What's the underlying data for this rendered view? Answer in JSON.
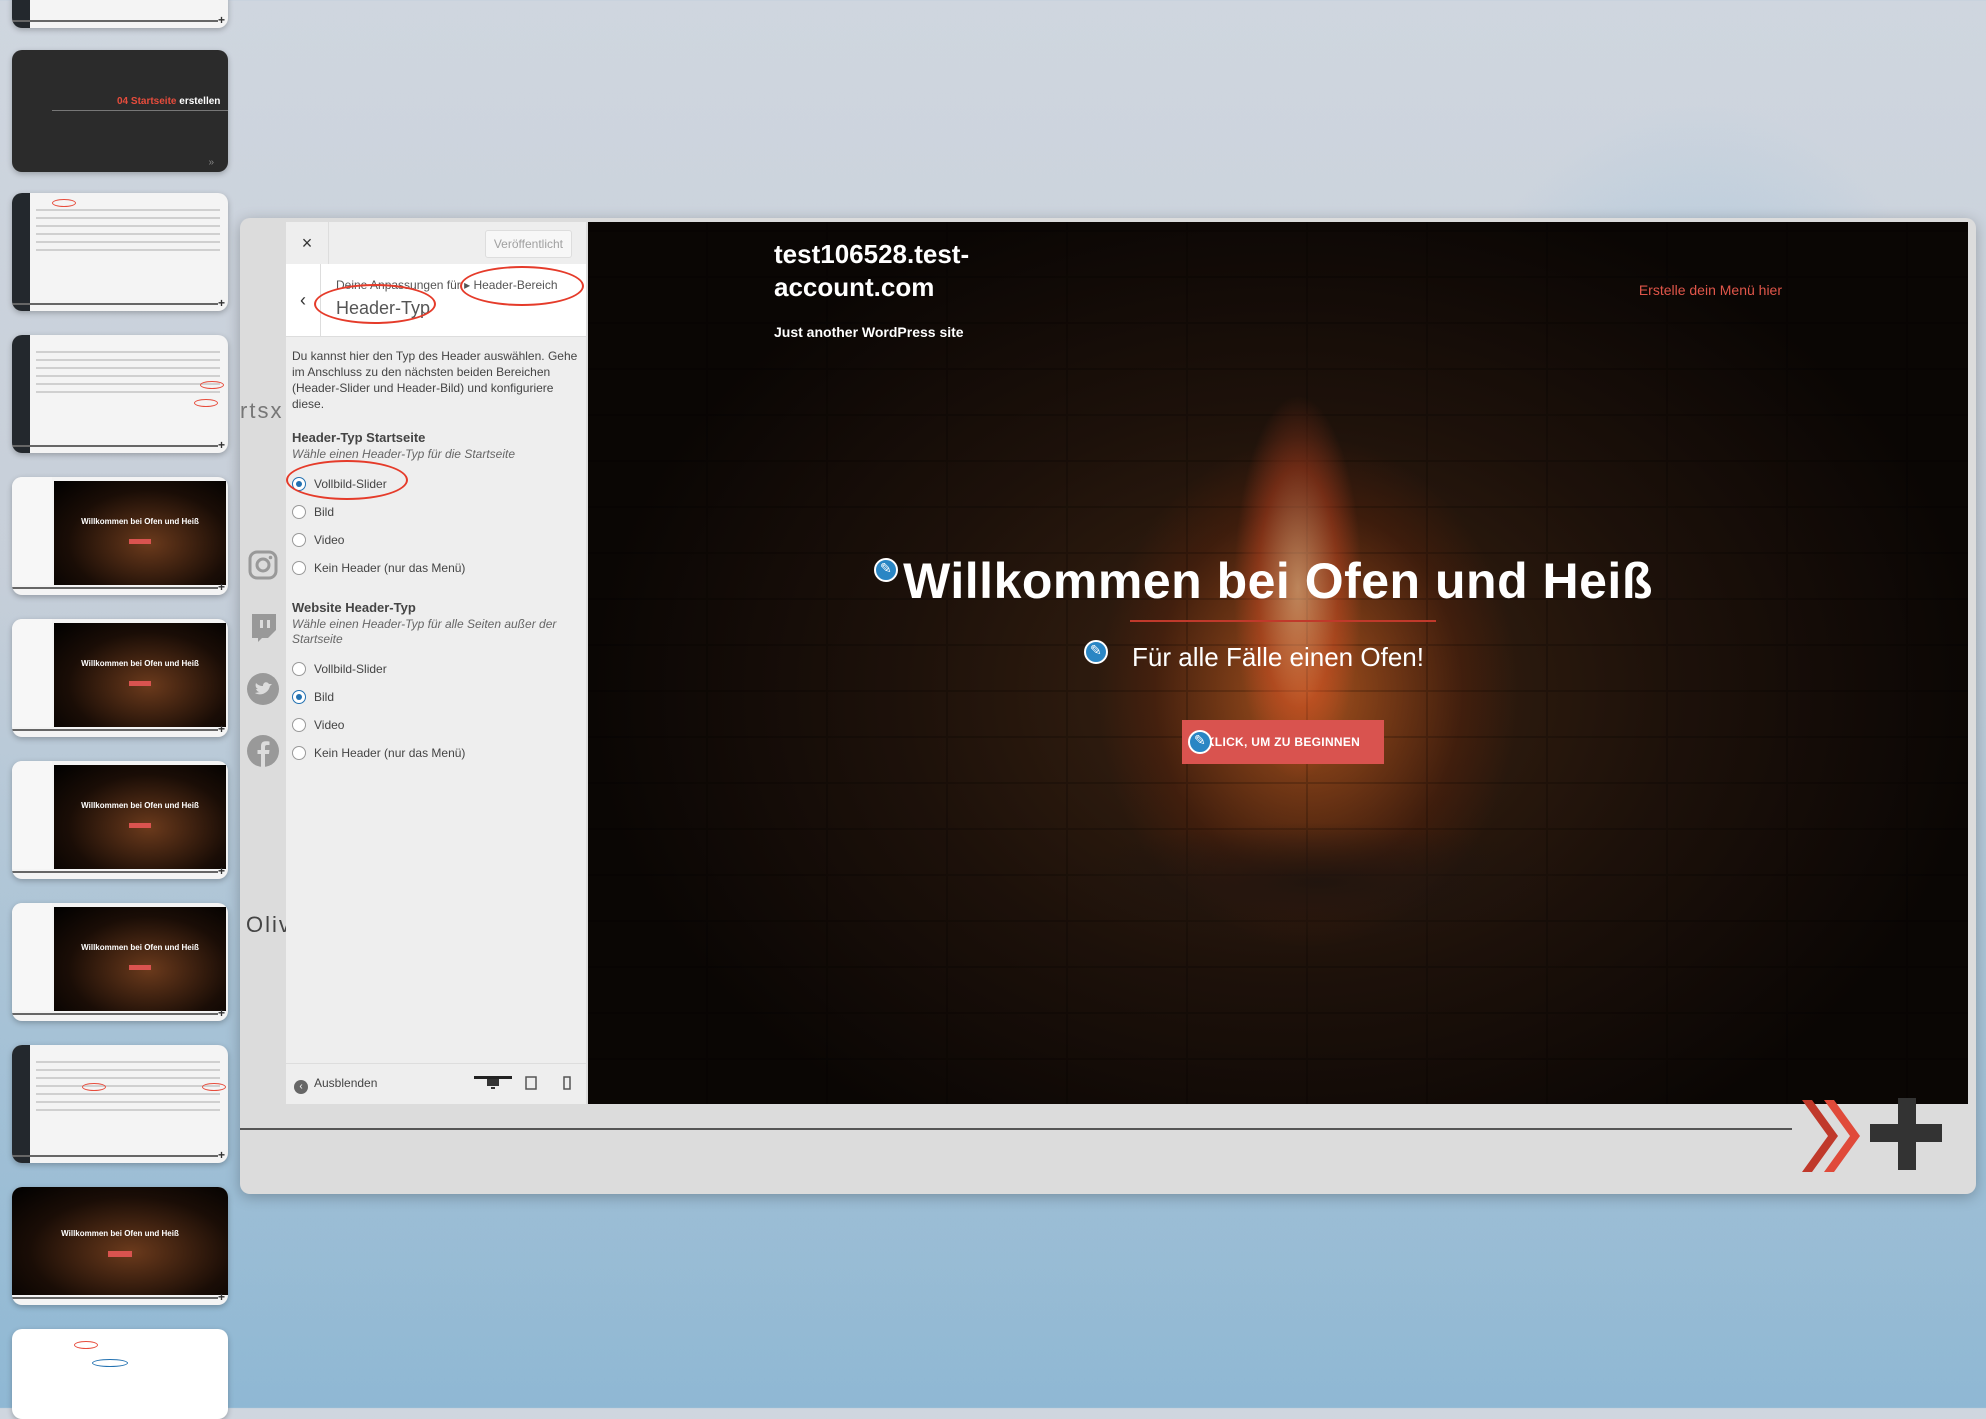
{
  "thumbnails": {
    "slide_title_red": "04 Startseite",
    "slide_title_white": "erstellen",
    "mini_hero_title": "Willkommen bei Ofen und Heiß"
  },
  "side_texts": {
    "left_top": "rtsx",
    "left_bottom": "Oliv"
  },
  "social_icons": [
    "instagram-icon",
    "twitch-icon",
    "twitter-icon",
    "facebook-icon"
  ],
  "customizer": {
    "close_label": "×",
    "publish_label": "Veröffentlicht",
    "back_label": "‹",
    "breadcrumb_prefix": "Deine Anpassungen für",
    "breadcrumb_section": "Header-Bereich",
    "section_title": "Header-Typ",
    "description": "Du kannst hier den Typ des Header auswählen. Gehe im Anschluss zu den nächsten beiden Bereichen (Header-Slider und Header-Bild) und konfiguriere diese.",
    "group1": {
      "title": "Header-Typ Startseite",
      "subtitle": "Wähle einen Header-Typ für die Startseite",
      "options": [
        "Vollbild-Slider",
        "Bild",
        "Video",
        "Kein Header (nur das Menü)"
      ],
      "selected": "Vollbild-Slider"
    },
    "group2": {
      "title": "Website Header-Typ",
      "subtitle": "Wähle einen Header-Typ für alle Seiten außer der Startseite",
      "options": [
        "Vollbild-Slider",
        "Bild",
        "Video",
        "Kein Header (nur das Menü)"
      ],
      "selected": "Bild"
    },
    "hide_label": "Ausblenden",
    "devices": [
      "desktop-icon",
      "tablet-icon",
      "mobile-icon"
    ]
  },
  "preview": {
    "site_title": "test106528.test-account.com",
    "tagline": "Just another WordPress site",
    "menu_text": "Erstelle dein Menü hier",
    "hero_title": "Willkommen bei Ofen und Heiß",
    "hero_subtitle": "Für alle Fälle einen Ofen!",
    "hero_button": "KLICK, UM ZU BEGINNEN"
  },
  "colors": {
    "accent_red": "#e53b2a",
    "wp_blue": "#2271b1",
    "button_red": "#d9534f"
  }
}
